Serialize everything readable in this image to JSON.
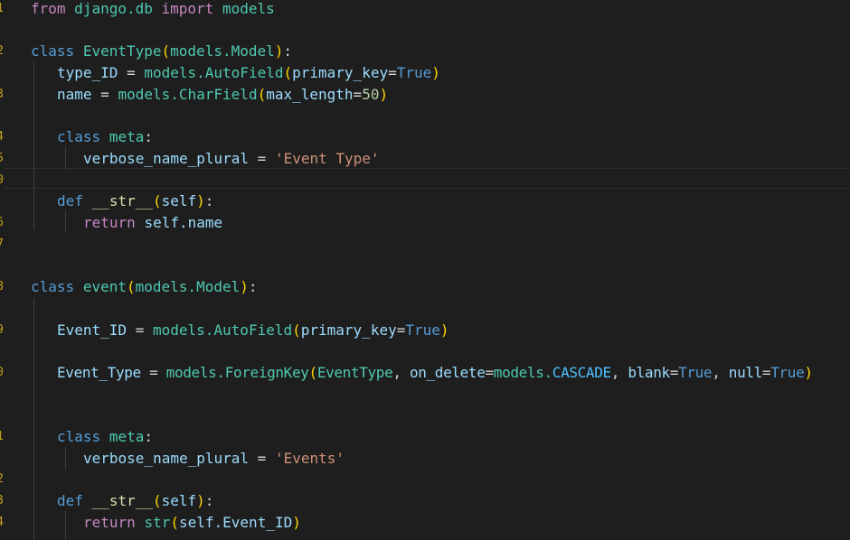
{
  "editor": {
    "language": "python",
    "theme_colors": {
      "background": "#1e1e1e",
      "keyword": "#569cd6",
      "control": "#c586c0",
      "class": "#4ec9b0",
      "function": "#dcdcaa",
      "variable": "#9cdcfe",
      "string": "#ce9178",
      "number": "#b5cea8",
      "line_number": "#c5a318"
    },
    "line_numbers": [
      "1",
      "2",
      "3",
      "4",
      "5",
      "6",
      "7",
      "8",
      "9",
      "0",
      "1",
      "2",
      "3",
      "4",
      "5",
      "6",
      "7",
      "8",
      "9",
      "0",
      "1",
      "2",
      "3",
      "4",
      "5"
    ],
    "t": {
      "from": "from",
      "django_db": "django.db",
      "import": "import",
      "models": "models",
      "class": "class",
      "EventType": "EventType",
      "lp": "(",
      "rp": ")",
      "models_dot": "models.",
      "Model": "Model",
      "rp_colon": "):",
      "type_ID": "type_ID",
      "eq": " = ",
      "AutoField": "AutoField",
      "primary_key": "primary_key",
      "eqo": "=",
      "True": "True",
      "name": "name",
      "CharField": "CharField",
      "max_length": "max_length",
      "fifty": "50",
      "meta": "meta",
      "colon": ":",
      "verbose_name_plural": "verbose_name_plural",
      "str_event_type": "'Event Type'",
      "def": "def",
      "dunder_str": "__str__",
      "self": "self",
      "return": "return",
      "self_dot": "self.",
      "event": "event",
      "Event_ID": "Event_ID",
      "Event_Type": "Event_Type",
      "ForeignKey": "ForeignKey",
      "comma": ", ",
      "on_delete": "on_delete",
      "CASCADE": "CASCADE",
      "blank": "blank",
      "null": "null",
      "str_events": "'Events'",
      "str": "str"
    }
  }
}
